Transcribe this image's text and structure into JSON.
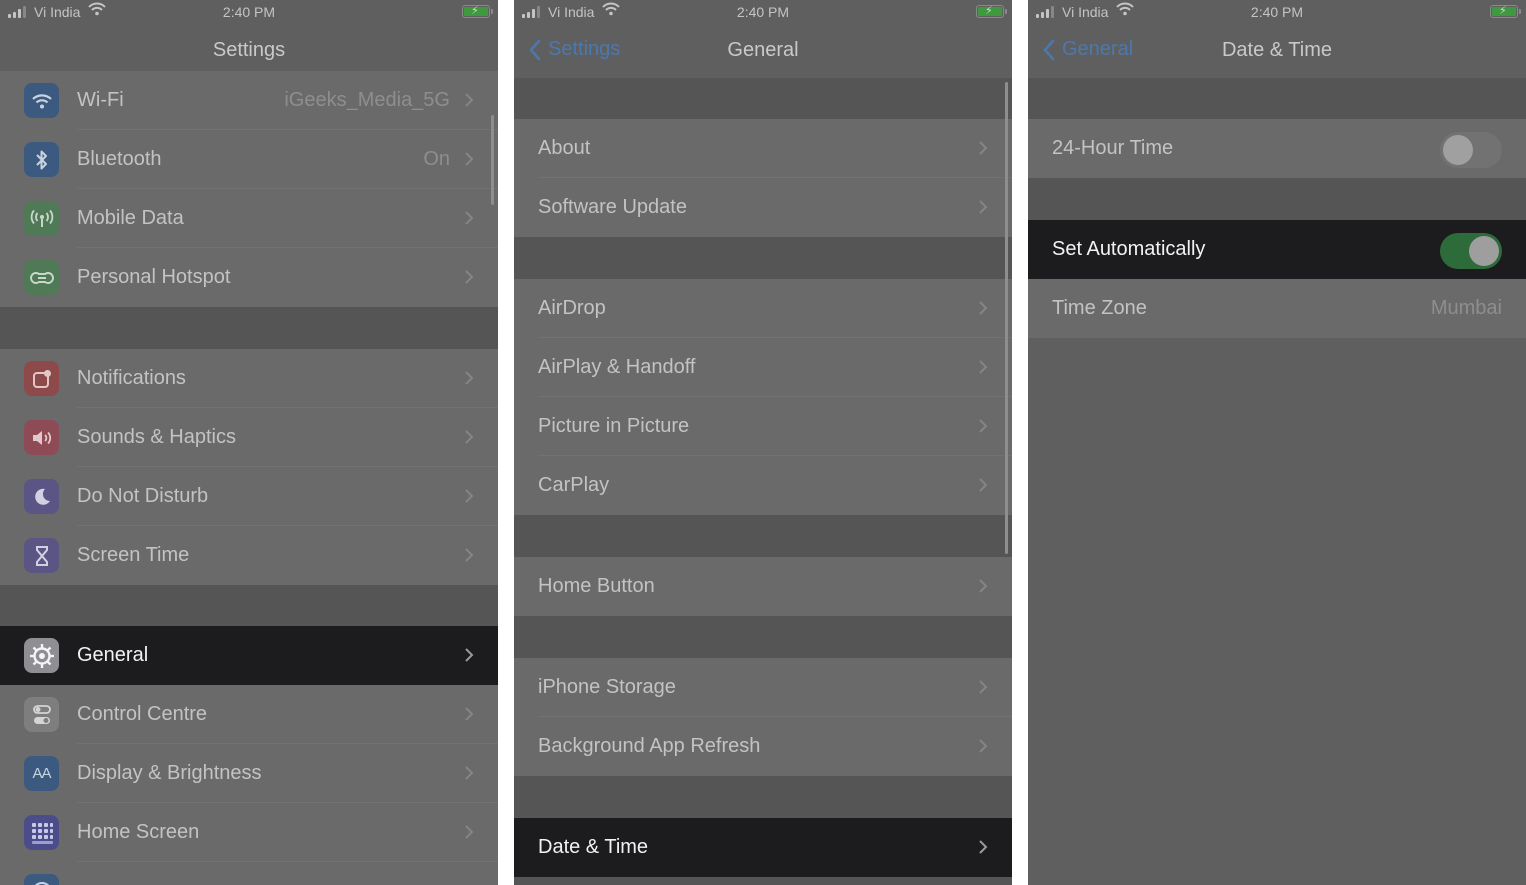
{
  "status": {
    "carrier": "Vi India",
    "time": "2:40 PM"
  },
  "colors": {
    "accent": "#4c78ad",
    "toggle_on": "#2d6b3a",
    "highlight": "#1c1c1e"
  },
  "screen1": {
    "title": "Settings",
    "rows": [
      {
        "label": "Wi-Fi",
        "value": "iGeeks_Media_5G",
        "icon": "wifi-icon"
      },
      {
        "label": "Bluetooth",
        "value": "On",
        "icon": "bluetooth-icon"
      },
      {
        "label": "Mobile Data",
        "icon": "antenna-icon"
      },
      {
        "label": "Personal Hotspot",
        "icon": "hotspot-icon"
      },
      {
        "label": "Notifications",
        "icon": "notifications-icon"
      },
      {
        "label": "Sounds & Haptics",
        "icon": "speaker-icon"
      },
      {
        "label": "Do Not Disturb",
        "icon": "moon-icon"
      },
      {
        "label": "Screen Time",
        "icon": "hourglass-icon"
      },
      {
        "label": "General",
        "icon": "gear-icon"
      },
      {
        "label": "Control Centre",
        "icon": "toggles-icon"
      },
      {
        "label": "Display & Brightness",
        "icon": "text-size-icon",
        "icon_text": "AA"
      },
      {
        "label": "Home Screen",
        "icon": "app-grid-icon"
      }
    ]
  },
  "screen2": {
    "back": "Settings",
    "title": "General",
    "rows": [
      {
        "label": "About"
      },
      {
        "label": "Software Update"
      },
      {
        "label": "AirDrop"
      },
      {
        "label": "AirPlay & Handoff"
      },
      {
        "label": "Picture in Picture"
      },
      {
        "label": "CarPlay"
      },
      {
        "label": "Home Button"
      },
      {
        "label": "iPhone Storage"
      },
      {
        "label": "Background App Refresh"
      },
      {
        "label": "Date & Time"
      }
    ]
  },
  "screen3": {
    "back": "General",
    "title": "Date & Time",
    "rows": [
      {
        "label": "24-Hour Time",
        "toggle_on": false
      },
      {
        "label": "Set Automatically",
        "toggle_on": true
      },
      {
        "label": "Time Zone",
        "value": "Mumbai"
      }
    ]
  }
}
